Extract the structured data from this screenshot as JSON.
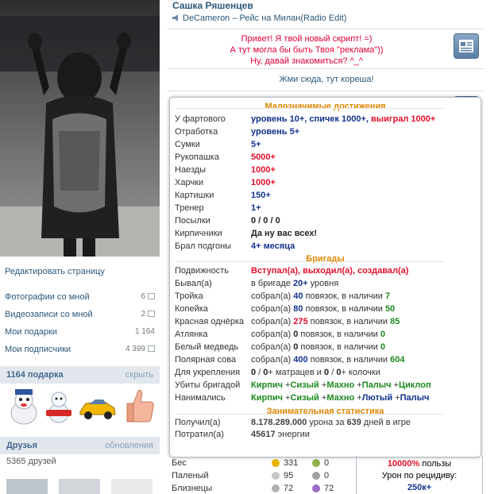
{
  "profile": {
    "name": "Сашка Ряшенцев",
    "status": "DeCameron – Рейс на Милан(Radio Edit)"
  },
  "left": {
    "edit_page": "Редактировать страницу",
    "links": [
      {
        "label": "Фотографии со мной",
        "count": "6"
      },
      {
        "label": "Видеозаписи со мной",
        "count": "2"
      },
      {
        "label": "Мои подарки",
        "count": "1 164"
      },
      {
        "label": "Мои подписчики",
        "count": "4 399"
      }
    ],
    "gifts_title": "1164 подарка",
    "gifts_action": "скрыть",
    "friends_title": "Друзья",
    "friends_action": "обновления",
    "friends_count": "5365 друзей"
  },
  "promo": {
    "line1": "Привет! Я твой новый скрипт! =)",
    "line2": "А тут могла бы быть Твоя \"реклама\"))",
    "line3": "Ну, давай знакомиться? ^_^",
    "link": "Жми сюда, тут кореша!"
  },
  "panel": {
    "title1": "Малозначимые достижения",
    "achievements": [
      {
        "label": "У фартового",
        "parts": [
          {
            "t": "уровень 10+, спичек 1000+, ",
            "c": "blue"
          },
          {
            "t": "выиграл 1000+",
            "c": "red"
          }
        ]
      },
      {
        "label": "Отработка",
        "parts": [
          {
            "t": "уровень 5+",
            "c": "blue"
          }
        ]
      },
      {
        "label": "Сумки",
        "parts": [
          {
            "t": "5+",
            "c": "blue"
          }
        ]
      },
      {
        "label": "Рукопашка",
        "parts": [
          {
            "t": "5000+",
            "c": "red"
          }
        ]
      },
      {
        "label": "Наезды",
        "parts": [
          {
            "t": "1000+",
            "c": "red"
          }
        ]
      },
      {
        "label": "Харчки",
        "parts": [
          {
            "t": "1000+",
            "c": "red"
          }
        ]
      },
      {
        "label": "Картишки",
        "parts": [
          {
            "t": "150+",
            "c": "blue"
          }
        ]
      },
      {
        "label": "Тренер",
        "parts": [
          {
            "t": "1+",
            "c": "blue"
          }
        ]
      },
      {
        "label": "Посылки",
        "parts": [
          {
            "t": "0 / 0 / 0",
            "c": "dark"
          }
        ]
      },
      {
        "label": "Кирпичники",
        "parts": [
          {
            "t": "Да ну вас всех!",
            "c": "dark"
          }
        ]
      },
      {
        "label": "Брал подгоны",
        "parts": [
          {
            "t": "4+ месяца",
            "c": "blue"
          }
        ]
      }
    ],
    "title2": "Бригады",
    "brigades": [
      {
        "label": "Подвижность",
        "parts": [
          {
            "t": "Вступал(а), выходил(а), создавал(а)",
            "c": "red"
          }
        ]
      },
      {
        "label": "Бывал(а)",
        "parts": [
          {
            "t": "в бригаде ",
            "c": "n"
          },
          {
            "t": "20+",
            "c": "blue"
          },
          {
            "t": " уровня",
            "c": "n"
          }
        ]
      },
      {
        "label": "Тройка",
        "parts": [
          {
            "t": "собрал(а) ",
            "c": "n"
          },
          {
            "t": "40",
            "c": "blue"
          },
          {
            "t": " повязок, в наличии ",
            "c": "n"
          },
          {
            "t": "7",
            "c": "green"
          }
        ]
      },
      {
        "label": "Копейка",
        "parts": [
          {
            "t": "собрал(а) ",
            "c": "n"
          },
          {
            "t": "80",
            "c": "blue"
          },
          {
            "t": " повязок, в наличии ",
            "c": "n"
          },
          {
            "t": "50",
            "c": "green"
          }
        ]
      },
      {
        "label": "Красная однёрка",
        "parts": [
          {
            "t": "собрал(а) ",
            "c": "n"
          },
          {
            "t": "275",
            "c": "red"
          },
          {
            "t": " повязок, в наличии ",
            "c": "n"
          },
          {
            "t": "85",
            "c": "green"
          }
        ]
      },
      {
        "label": "Атлянка",
        "parts": [
          {
            "t": "собрал(а) ",
            "c": "n"
          },
          {
            "t": "0",
            "c": "dark"
          },
          {
            "t": " повязок, в наличии ",
            "c": "n"
          },
          {
            "t": "0",
            "c": "green"
          }
        ]
      },
      {
        "label": "Белый медведь",
        "parts": [
          {
            "t": "собрал(а) ",
            "c": "n"
          },
          {
            "t": "0",
            "c": "dark"
          },
          {
            "t": " повязок, в наличии ",
            "c": "n"
          },
          {
            "t": "0",
            "c": "green"
          }
        ]
      },
      {
        "label": "Полярная сова",
        "parts": [
          {
            "t": "собрал(а) ",
            "c": "n"
          },
          {
            "t": "400",
            "c": "blue"
          },
          {
            "t": " повязок, в наличии ",
            "c": "n"
          },
          {
            "t": "604",
            "c": "green"
          }
        ]
      },
      {
        "label": "Для укрепления",
        "parts": [
          {
            "t": "0",
            "c": "dark"
          },
          {
            "t": " / ",
            "c": "n"
          },
          {
            "t": "0",
            "c": "dark"
          },
          {
            "t": "+ матрацев и ",
            "c": "n"
          },
          {
            "t": "0",
            "c": "dark"
          },
          {
            "t": " / ",
            "c": "n"
          },
          {
            "t": "0",
            "c": "dark"
          },
          {
            "t": "+ колочки",
            "c": "n"
          }
        ]
      },
      {
        "label": "Убиты бригадой",
        "parts": [
          {
            "t": "Кирпич",
            "c": "green"
          },
          {
            "t": " +",
            "c": "n"
          },
          {
            "t": "Сизый",
            "c": "green"
          },
          {
            "t": " +",
            "c": "n"
          },
          {
            "t": "Махно",
            "c": "green"
          },
          {
            "t": " +",
            "c": "n"
          },
          {
            "t": "Палыч",
            "c": "green"
          },
          {
            "t": " +",
            "c": "n"
          },
          {
            "t": "Циклоп",
            "c": "green"
          }
        ]
      },
      {
        "label": "Нанимались",
        "parts": [
          {
            "t": "Кирпич",
            "c": "green"
          },
          {
            "t": " +",
            "c": "n"
          },
          {
            "t": "Сизый",
            "c": "green"
          },
          {
            "t": " +",
            "c": "n"
          },
          {
            "t": "Махно",
            "c": "green"
          },
          {
            "t": " +",
            "c": "n"
          },
          {
            "t": "Лютый",
            "c": "blue"
          },
          {
            "t": " +",
            "c": "n"
          },
          {
            "t": "Палыч",
            "c": "blue"
          }
        ]
      }
    ],
    "title3": "Занимательная статистика",
    "stats": [
      {
        "label": "Получил(а)",
        "parts": [
          {
            "t": "8.178.289.000",
            "c": "grey"
          },
          {
            "t": " урона за ",
            "c": "n"
          },
          {
            "t": "639",
            "c": "grey"
          },
          {
            "t": " дней в игре",
            "c": "n"
          }
        ]
      },
      {
        "label": "Потратил(а)",
        "parts": [
          {
            "t": "45617",
            "c": "grey"
          },
          {
            "t": " энергии",
            "c": "n"
          }
        ]
      }
    ]
  },
  "bottom": {
    "rows": [
      {
        "label": "Бес",
        "a": "331",
        "b": "0"
      },
      {
        "label": "Паленый",
        "a": "95",
        "b": "0"
      },
      {
        "label": "Близнецы",
        "a": "72",
        "b": "72"
      }
    ],
    "box_line1": "10000%",
    "box_line1_suffix": " пользы",
    "box_line2": "Урон по рецидиву:",
    "box_line3": "250к+"
  }
}
